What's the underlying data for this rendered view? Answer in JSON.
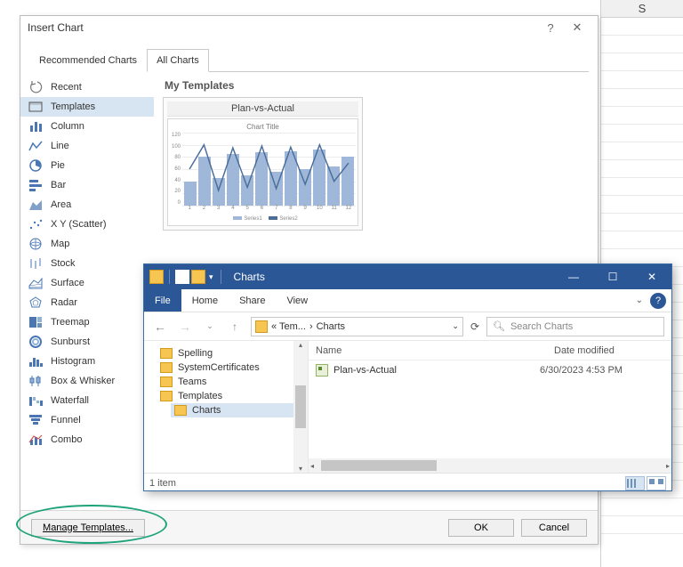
{
  "spreadsheet": {
    "column_letter": "S"
  },
  "dialog": {
    "title": "Insert Chart",
    "help": "?",
    "close": "✕",
    "tabs": {
      "recommended": "Recommended Charts",
      "all": "All Charts"
    },
    "categories": [
      "Recent",
      "Templates",
      "Column",
      "Line",
      "Pie",
      "Bar",
      "Area",
      "X Y (Scatter)",
      "Map",
      "Stock",
      "Surface",
      "Radar",
      "Treemap",
      "Sunburst",
      "Histogram",
      "Box & Whisker",
      "Waterfall",
      "Funnel",
      "Combo"
    ],
    "selected_category": "Templates",
    "preview": {
      "section_title": "My Templates",
      "template_name": "Plan-vs-Actual",
      "chart_title_label": "Chart Title",
      "legend": {
        "s1": "Series1",
        "s2": "Series2"
      }
    },
    "buttons": {
      "manage": "Manage Templates...",
      "ok": "OK",
      "cancel": "Cancel"
    }
  },
  "chart_data": {
    "type": "bar",
    "title": "Chart Title",
    "ylim": [
      0,
      120
    ],
    "yticks": [
      0,
      20,
      40,
      60,
      80,
      100,
      120
    ],
    "categories": [
      1,
      2,
      3,
      4,
      5,
      6,
      7,
      8,
      9,
      10,
      11,
      12
    ],
    "series": [
      {
        "name": "Series1",
        "type": "bar",
        "values": [
          40,
          80,
          45,
          85,
          50,
          88,
          55,
          90,
          60,
          92,
          65,
          80
        ]
      },
      {
        "name": "Series2",
        "type": "line",
        "values": [
          60,
          100,
          25,
          95,
          30,
          98,
          28,
          96,
          35,
          100,
          40,
          70
        ]
      }
    ]
  },
  "explorer": {
    "window_title": "Charts",
    "ribbon": {
      "file": "File",
      "home": "Home",
      "share": "Share",
      "view": "View"
    },
    "breadcrumb": {
      "prefix": "« Tem...",
      "current": "Charts"
    },
    "search_placeholder": "Search Charts",
    "tree": [
      "Spelling",
      "SystemCertificates",
      "Teams",
      "Templates",
      "Charts"
    ],
    "tree_selected": "Charts",
    "columns": {
      "name": "Name",
      "date": "Date modified"
    },
    "files": [
      {
        "name": "Plan-vs-Actual",
        "date": "6/30/2023 4:53 PM"
      }
    ],
    "status": "1 item"
  }
}
